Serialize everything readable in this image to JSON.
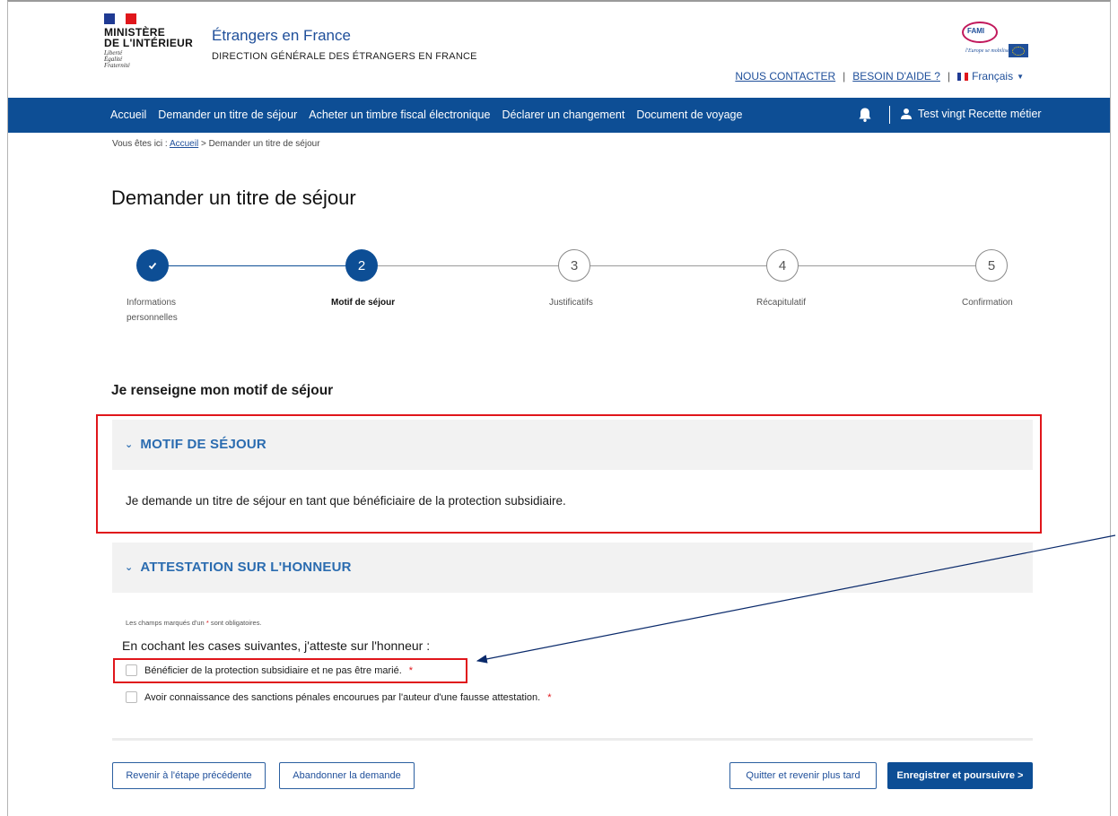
{
  "header": {
    "logo": {
      "line1": "MINISTÈRE",
      "line2": "DE L'INTÉRIEUR",
      "motto1": "Liberté",
      "motto2": "Égalité",
      "motto3": "Fraternité"
    },
    "site_title": "Étrangers en France",
    "site_subtitle": "DIRECTION GÉNÉRALE DES ÉTRANGERS EN FRANCE",
    "partner_logo": {
      "text": "FAMI",
      "slogan": "l'Europe se mobilise"
    },
    "links": {
      "contact": "NOUS CONTACTER",
      "help": "BESOIN D'AIDE ?",
      "separator": "|",
      "language": "Français"
    }
  },
  "nav": {
    "items": [
      "Accueil",
      "Demander un titre de séjour",
      "Acheter un timbre fiscal électronique",
      "Déclarer un changement",
      "Document de voyage"
    ],
    "user_name": "Test vingt Recette métier"
  },
  "breadcrumb": {
    "prefix": "Vous êtes ici :",
    "home": "Accueil",
    "current": "> Demander un titre de séjour"
  },
  "page_title": "Demander un titre de séjour",
  "stepper": {
    "steps": [
      {
        "number": "✓",
        "label": "Informations personnelles",
        "state": "done"
      },
      {
        "number": "2",
        "label": "Motif de séjour",
        "state": "current"
      },
      {
        "number": "3",
        "label": "Justificatifs",
        "state": "todo"
      },
      {
        "number": "4",
        "label": "Récapitulatif",
        "state": "todo"
      },
      {
        "number": "5",
        "label": "Confirmation",
        "state": "todo"
      }
    ]
  },
  "section_heading": "Je renseigne mon motif de séjour",
  "motif_panel": {
    "title": "MOTIF DE SÉJOUR",
    "body": "Je demande un titre de séjour en tant que bénéficiaire de la protection subsidiaire."
  },
  "attestation_panel": {
    "title": "ATTESTATION SUR L'HONNEUR",
    "required_note_prefix": "Les champs marqués d'un",
    "required_note_star": "*",
    "required_note_suffix": "sont obligatoires.",
    "intro": "En cochant les cases suivantes, j'atteste sur l'honneur :",
    "checkboxes": [
      {
        "label": "Bénéficier de la protection subsidiaire et ne pas être marié.",
        "required_mark": "*"
      },
      {
        "label": "Avoir connaissance des sanctions pénales encourues par l'auteur d'une fausse attestation.",
        "required_mark": "*"
      }
    ]
  },
  "buttons": {
    "previous": "Revenir à l'étape précédente",
    "abandon": "Abandonner la demande",
    "quit": "Quitter et revenir plus tard",
    "save_continue": "Enregistrer et poursuivre >"
  },
  "colors": {
    "primary": "#0d4e95",
    "accent_blue": "#2b6cb0",
    "highlight_red": "#e0161b"
  }
}
